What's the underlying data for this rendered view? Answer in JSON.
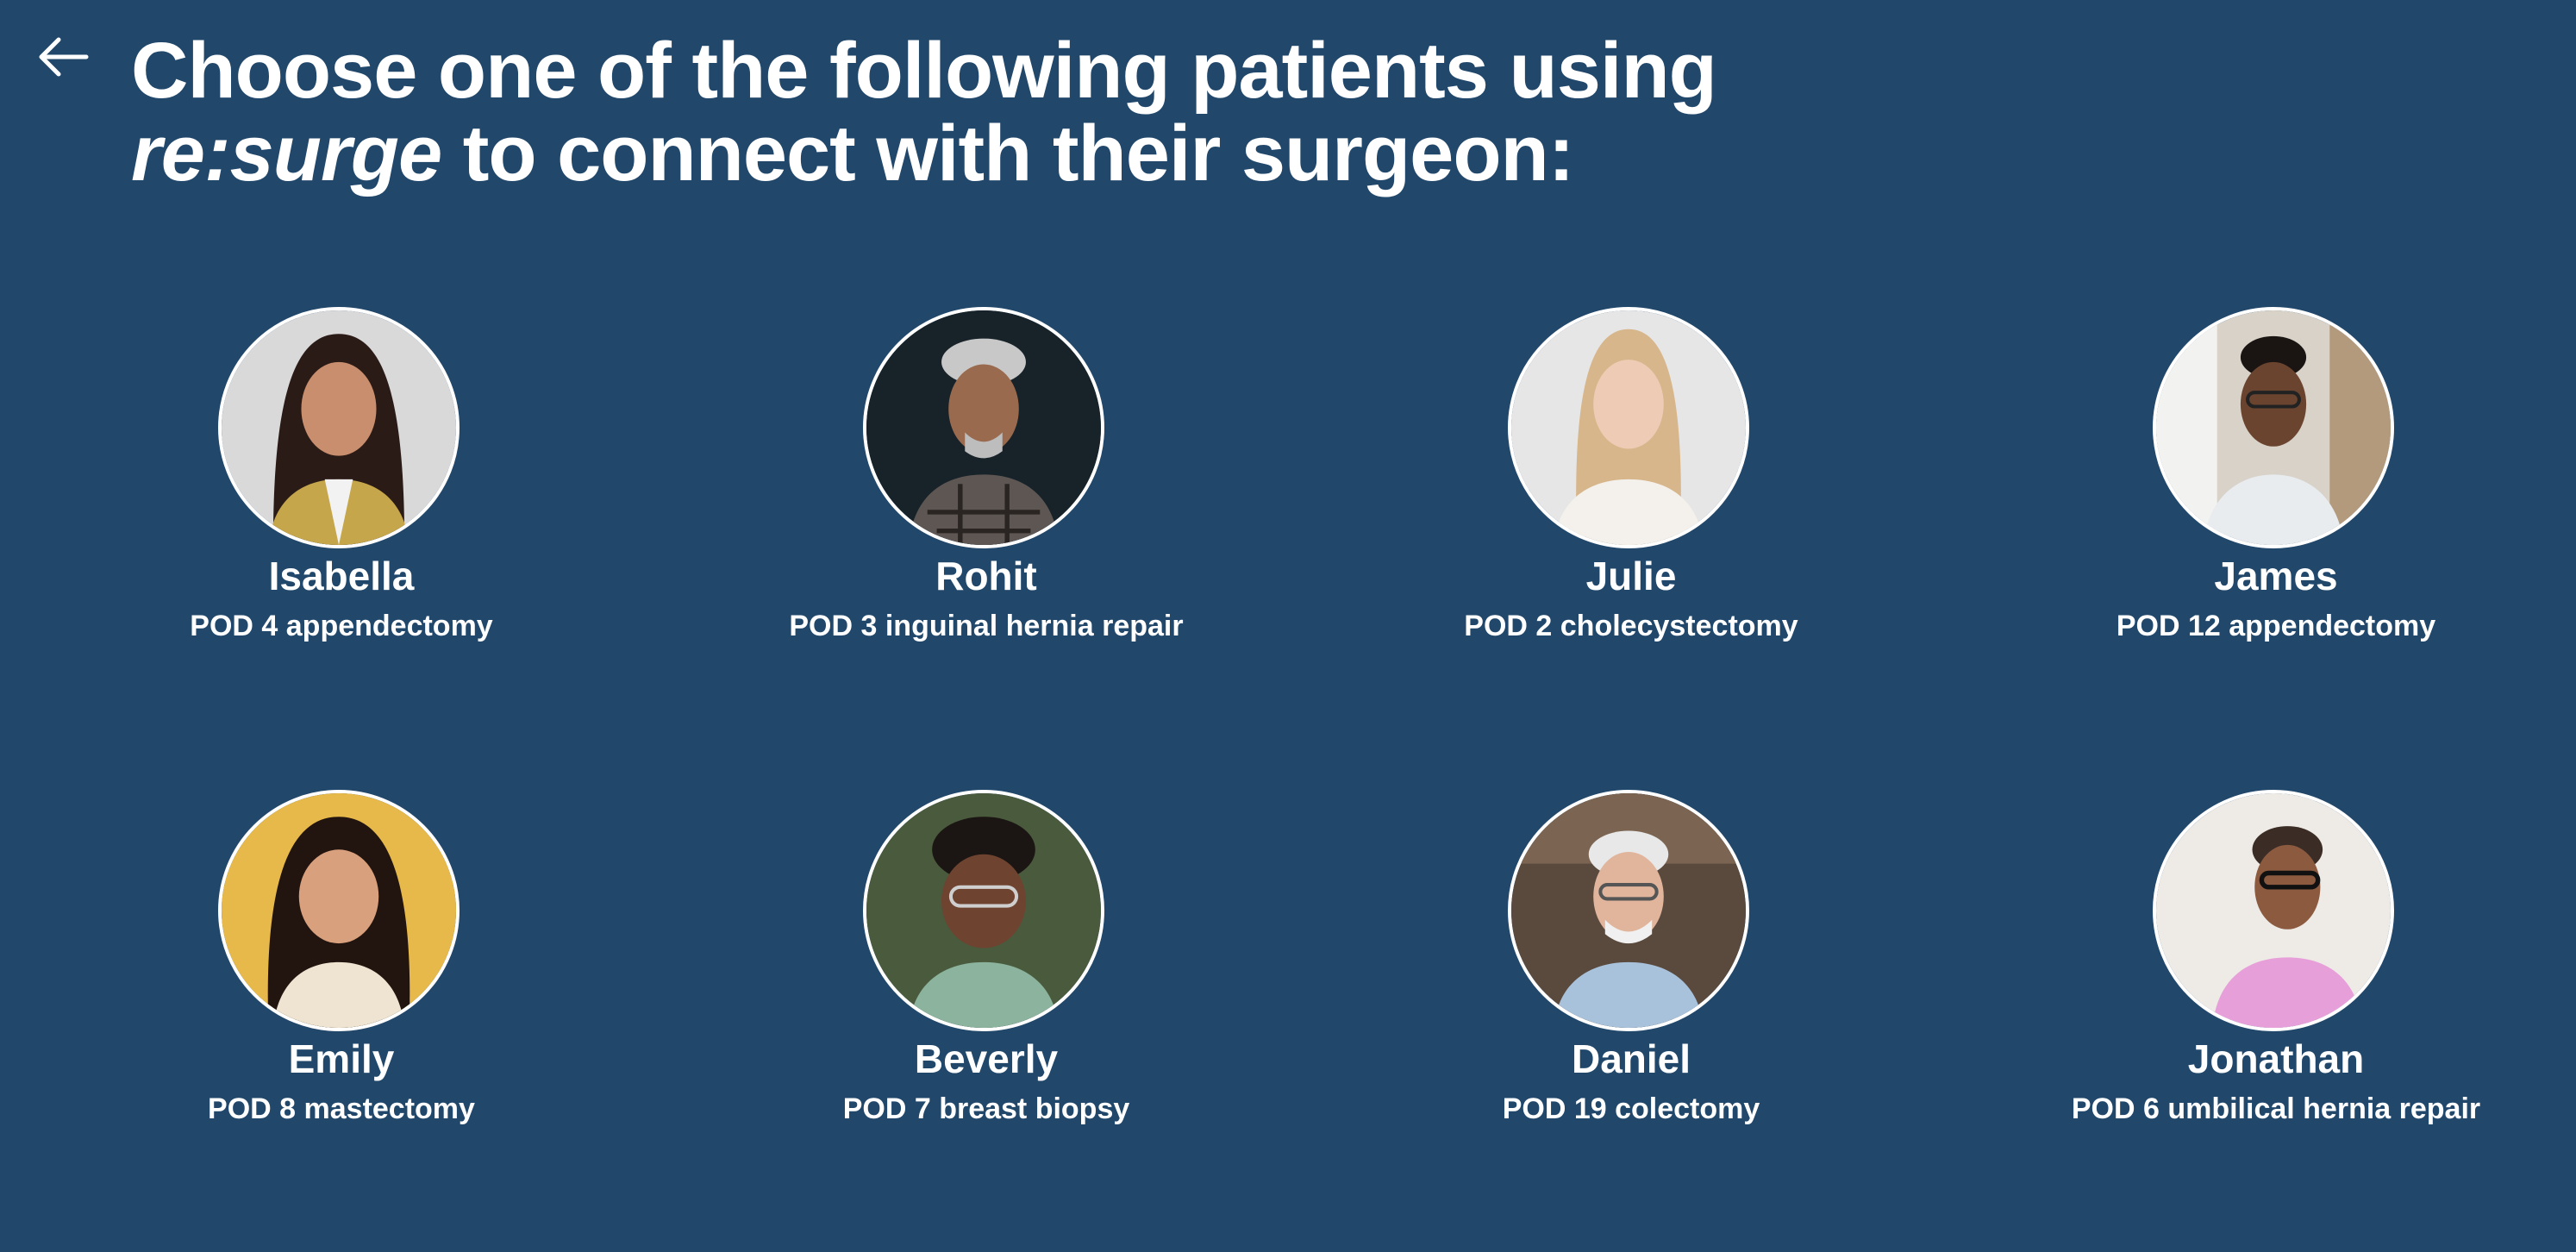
{
  "header": {
    "back_icon": "arrow-left-icon",
    "title_line1": "Choose one of the following patients using",
    "title_brand": "re:surge",
    "title_line2_rest": " to connect with their surgeon:"
  },
  "patients": [
    {
      "name": "Isabella",
      "procedure": "POD 4 appendectomy"
    },
    {
      "name": "Rohit",
      "procedure": "POD 3 inguinal hernia repair"
    },
    {
      "name": "Julie",
      "procedure": "POD 2 cholecystectomy"
    },
    {
      "name": "James",
      "procedure": "POD 12 appendectomy"
    },
    {
      "name": "Emily",
      "procedure": "POD 8 mastectomy"
    },
    {
      "name": "Beverly",
      "procedure": "POD 7 breast biopsy"
    },
    {
      "name": "Daniel",
      "procedure": "POD 19 colectomy"
    },
    {
      "name": "Jonathan",
      "procedure": "POD 6 umbilical hernia repair"
    }
  ],
  "colors": {
    "background": "#21476b",
    "text": "#ffffff"
  }
}
